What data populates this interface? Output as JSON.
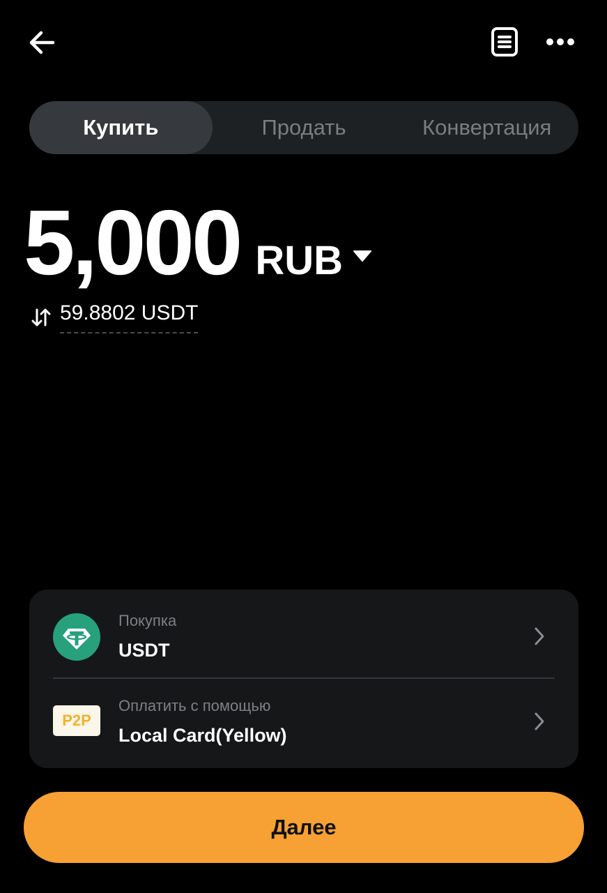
{
  "header": {
    "back_icon": "arrow-left-icon",
    "orders_icon": "document-icon",
    "more_icon": "ellipsis-icon"
  },
  "tabs": [
    {
      "label": "Купить",
      "active": true
    },
    {
      "label": "Продать",
      "active": false
    },
    {
      "label": "Конвертация",
      "active": false
    }
  ],
  "amount": {
    "value": "5,000",
    "currency": "RUB",
    "converted": "59.8802 USDT"
  },
  "card": {
    "buy": {
      "label": "Покупка",
      "value": "USDT",
      "icon": "tether-icon"
    },
    "pay": {
      "label": "Оплатить с помощью",
      "value": "Local Card(Yellow)",
      "badge": "P2P"
    }
  },
  "cta_label": "Далее",
  "colors": {
    "background": "#000000",
    "accent": "#f7a033",
    "tether": "#26a17b",
    "p2p": "#f0b229"
  }
}
